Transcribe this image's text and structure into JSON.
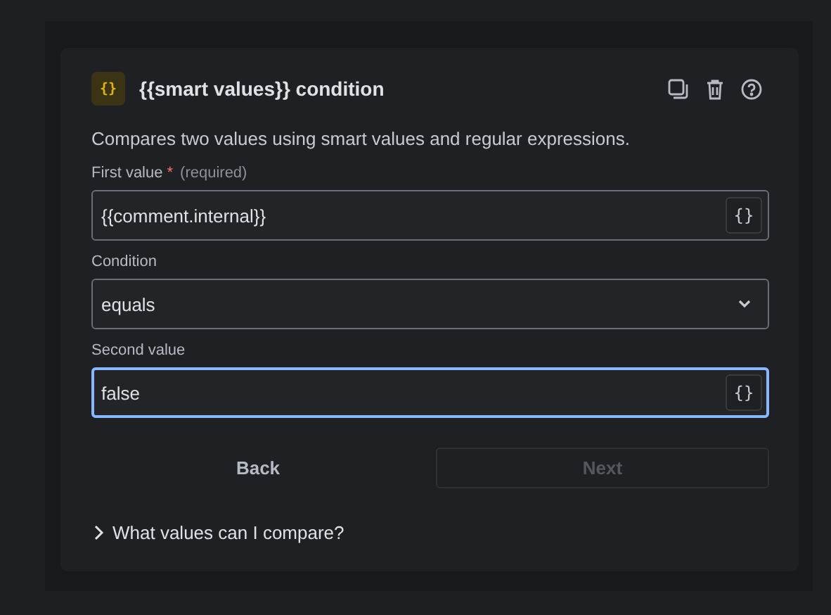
{
  "header": {
    "icon": "{}",
    "title": "{{smart values}} condition",
    "description": "Compares two values using smart values and regular expressions."
  },
  "fields": [
    {
      "kind": "text",
      "label": "First value",
      "required_mark": "*",
      "hint": "(required)",
      "value": "{{comment.internal}}",
      "focused": false,
      "button": "{}"
    },
    {
      "kind": "select",
      "label": "Condition",
      "value": "equals",
      "focused": false
    },
    {
      "kind": "text",
      "label": "Second value",
      "value": "false",
      "focused": true,
      "button": "{}"
    }
  ],
  "buttons": [
    {
      "label": "Back",
      "disabled": false,
      "kind": "subtle"
    },
    {
      "label": "Next",
      "disabled": true,
      "kind": "outline"
    }
  ],
  "expander": {
    "label": "What values can I compare?",
    "expanded": false
  }
}
